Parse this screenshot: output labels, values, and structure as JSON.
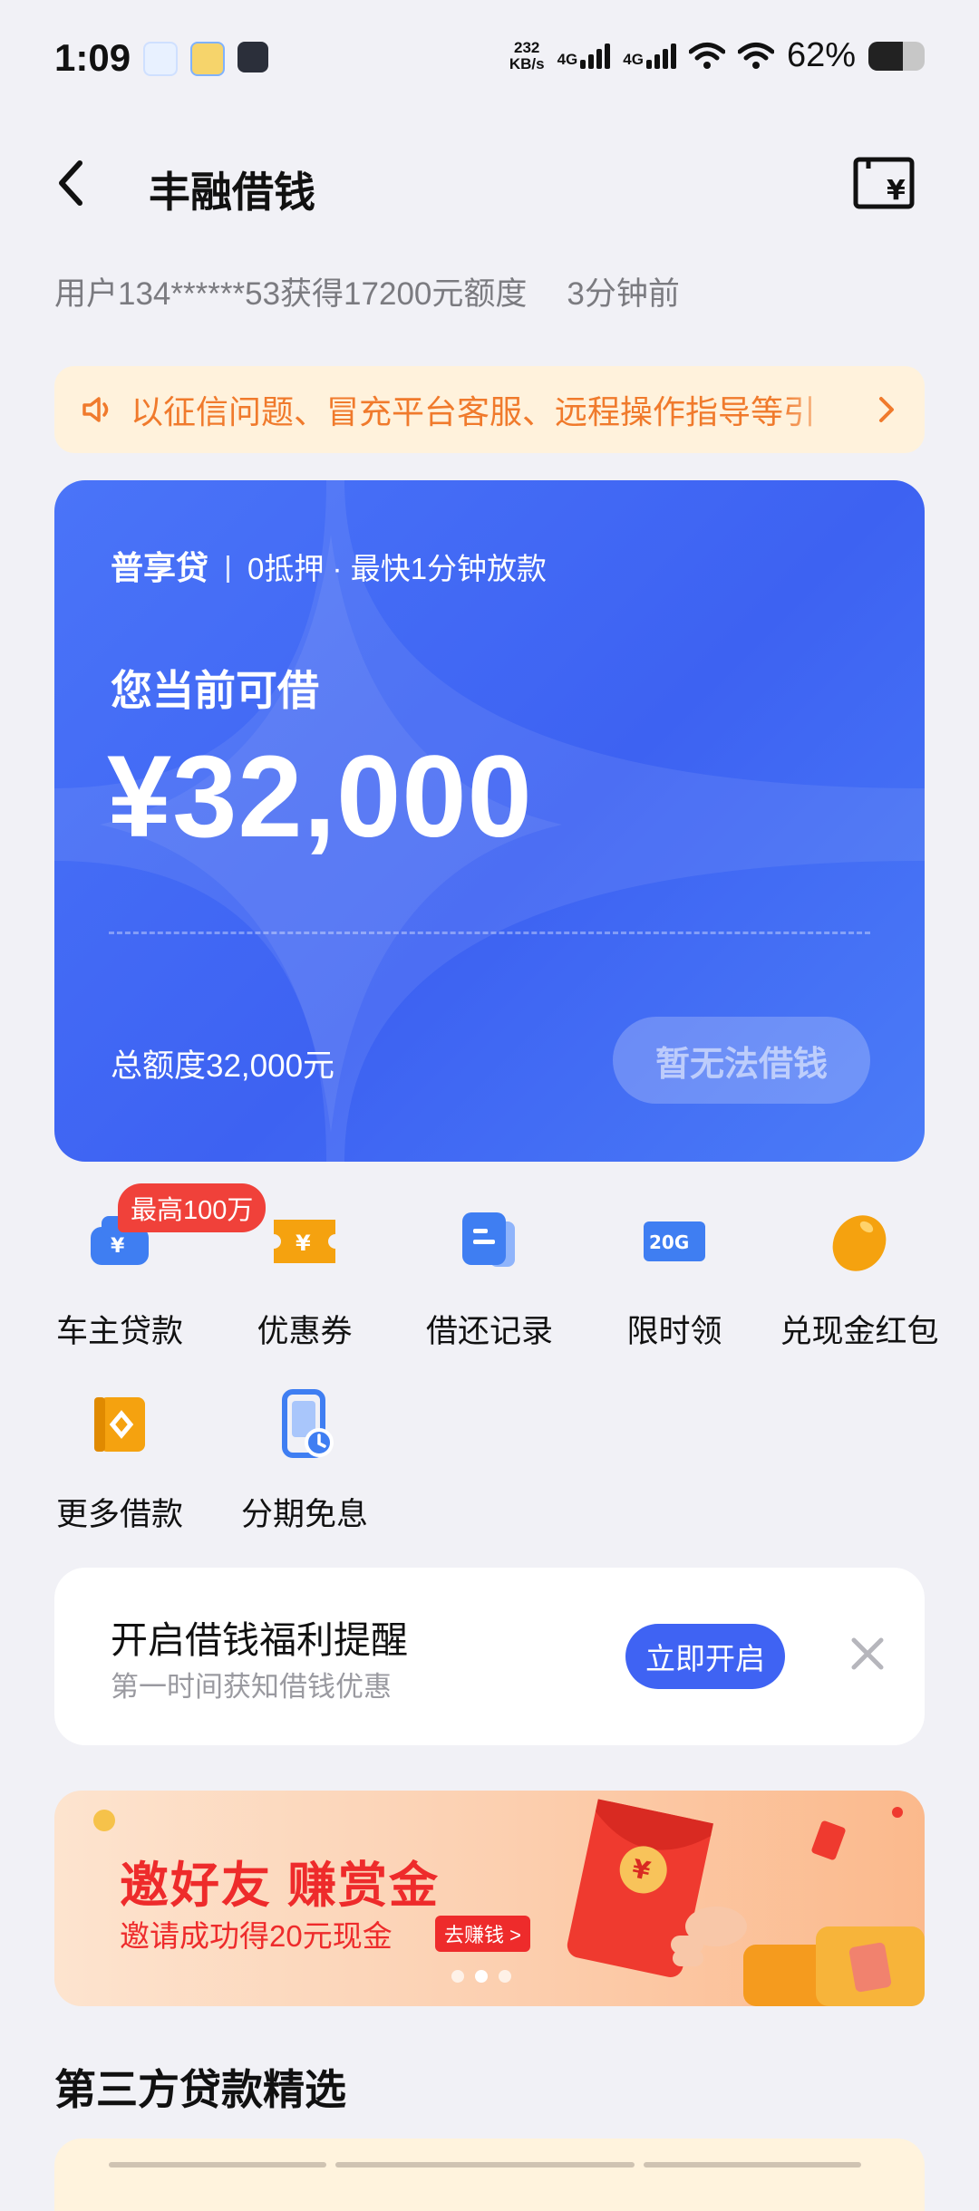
{
  "status": {
    "time": "1:09",
    "net_speed_value": "232",
    "net_speed_unit": "KB/s",
    "net1": "4G",
    "net2": "4G",
    "battery": "62%",
    "battery_level": 0.62
  },
  "header": {
    "title": "丰融借钱"
  },
  "info": {
    "text": "用户134******53获得17200元额度",
    "time": "3分钟前"
  },
  "notice": {
    "text": "以征信问题、冒充平台客服、远程操作指导等引"
  },
  "card": {
    "product": "普享贷",
    "subtitle": "0抵押 · 最快1分钟放款",
    "label": "您当前可借",
    "amount": "¥32,000",
    "total": "总额度32,000元",
    "button": "暂无法借钱"
  },
  "quick": {
    "badge": "最高100万",
    "items": [
      {
        "label": "车主贷款",
        "color": "#3f7ef2"
      },
      {
        "label": "优惠券",
        "color": "#f5a20f"
      },
      {
        "label": "借还记录",
        "color": "#3f7ef2"
      },
      {
        "label": "限时领",
        "icon_text": "20G",
        "color": "#3f7ef2"
      },
      {
        "label": "兑现金红包",
        "color": "#f5a20f"
      },
      {
        "label": "更多借款",
        "color": "#f5a20f"
      },
      {
        "label": "分期免息",
        "color": "#3f7ef2"
      }
    ]
  },
  "reminder": {
    "title": "开启借钱福利提醒",
    "subtitle": "第一时间获知借钱优惠",
    "button": "立即开启"
  },
  "banner": {
    "title": "邀好友 赚赏金",
    "subtitle": "邀请成功得20元现金",
    "pill": "去赚钱 >"
  },
  "section": {
    "title": "第三方贷款精选"
  }
}
